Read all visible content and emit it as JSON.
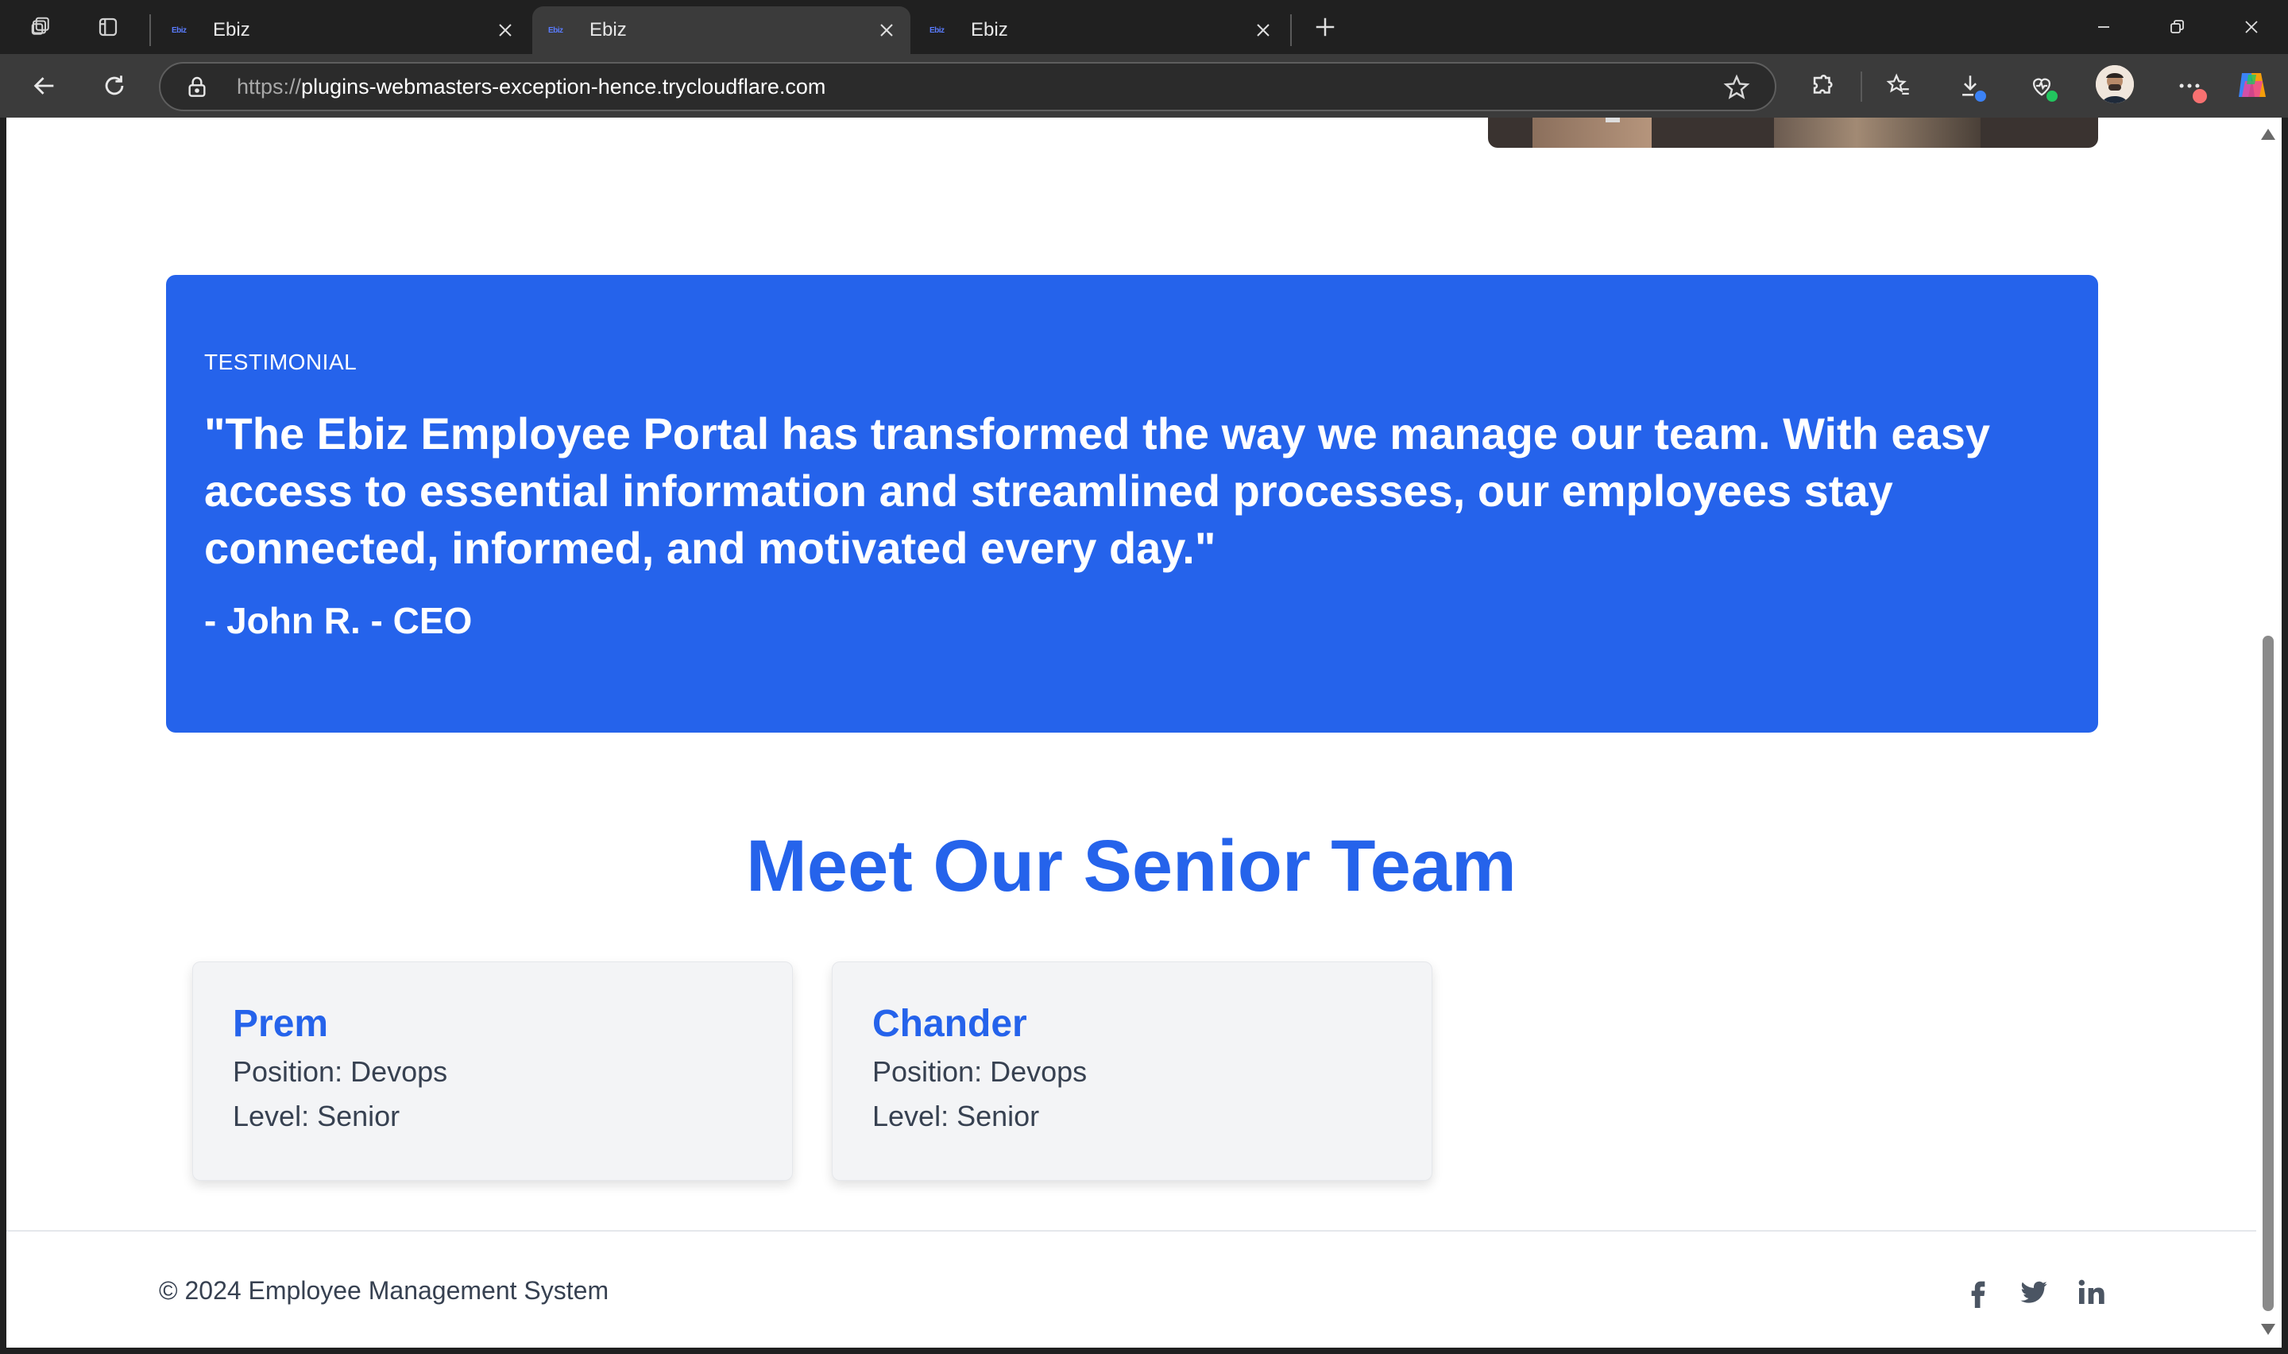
{
  "browser": {
    "tabs": [
      {
        "favicon": "Ebiz",
        "title": "Ebiz",
        "active": false
      },
      {
        "favicon": "Ebiz",
        "title": "Ebiz",
        "active": true
      },
      {
        "favicon": "Ebiz",
        "title": "Ebiz",
        "active": false
      }
    ],
    "address": {
      "scheme": "https://",
      "host": "plugins-webmasters-exception-hence.trycloudflare.com"
    },
    "colors": {
      "chrome_dark": "#202020",
      "toolbar": "#3b3b3b",
      "download_badge": "#3b82f6",
      "health_badge": "#22c55e",
      "menu_badge": "#f87171"
    }
  },
  "testimonial": {
    "label": "TESTIMONIAL",
    "quote": "\"The Ebiz Employee Portal has transformed the way we manage our team. With easy access to essential information and streamlined processes, our employees stay connected, informed, and motivated every day.\"",
    "author": "- John R. - CEO"
  },
  "team": {
    "title": "Meet Our Senior Team",
    "members": [
      {
        "name": "Prem",
        "position": "Position: Devops",
        "level": "Level: Senior"
      },
      {
        "name": "Chander",
        "position": "Position: Devops",
        "level": "Level: Senior"
      }
    ]
  },
  "footer": {
    "copyright": "© 2024 Employee Management System",
    "social": [
      "facebook-icon",
      "twitter-icon",
      "linkedin-icon"
    ]
  },
  "colors": {
    "accent": "#2563eb",
    "card_bg": "#f3f4f6",
    "text_body": "#374151"
  }
}
